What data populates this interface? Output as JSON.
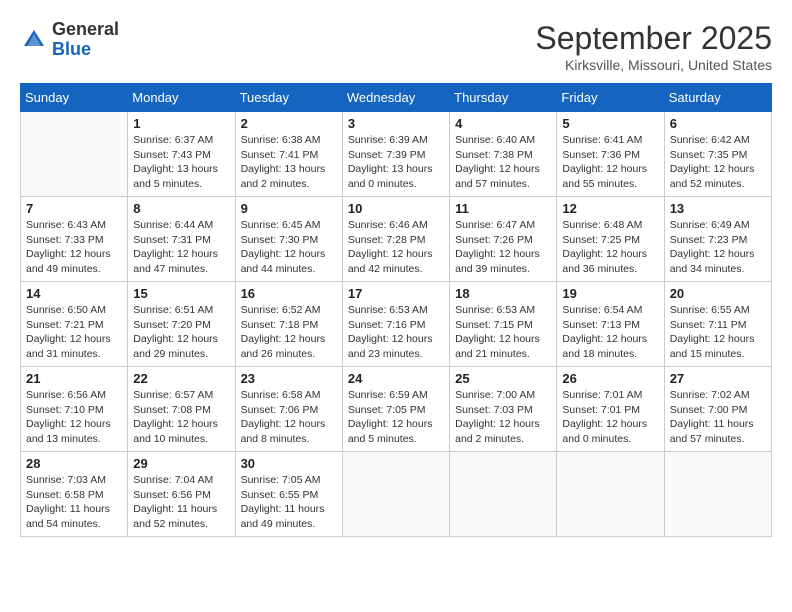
{
  "logo": {
    "general": "General",
    "blue": "Blue"
  },
  "header": {
    "month": "September 2025",
    "location": "Kirksville, Missouri, United States"
  },
  "days_of_week": [
    "Sunday",
    "Monday",
    "Tuesday",
    "Wednesday",
    "Thursday",
    "Friday",
    "Saturday"
  ],
  "weeks": [
    [
      {
        "day": "",
        "sunrise": "",
        "sunset": "",
        "daylight": ""
      },
      {
        "day": "1",
        "sunrise": "Sunrise: 6:37 AM",
        "sunset": "Sunset: 7:43 PM",
        "daylight": "Daylight: 13 hours and 5 minutes."
      },
      {
        "day": "2",
        "sunrise": "Sunrise: 6:38 AM",
        "sunset": "Sunset: 7:41 PM",
        "daylight": "Daylight: 13 hours and 2 minutes."
      },
      {
        "day": "3",
        "sunrise": "Sunrise: 6:39 AM",
        "sunset": "Sunset: 7:39 PM",
        "daylight": "Daylight: 13 hours and 0 minutes."
      },
      {
        "day": "4",
        "sunrise": "Sunrise: 6:40 AM",
        "sunset": "Sunset: 7:38 PM",
        "daylight": "Daylight: 12 hours and 57 minutes."
      },
      {
        "day": "5",
        "sunrise": "Sunrise: 6:41 AM",
        "sunset": "Sunset: 7:36 PM",
        "daylight": "Daylight: 12 hours and 55 minutes."
      },
      {
        "day": "6",
        "sunrise": "Sunrise: 6:42 AM",
        "sunset": "Sunset: 7:35 PM",
        "daylight": "Daylight: 12 hours and 52 minutes."
      }
    ],
    [
      {
        "day": "7",
        "sunrise": "Sunrise: 6:43 AM",
        "sunset": "Sunset: 7:33 PM",
        "daylight": "Daylight: 12 hours and 49 minutes."
      },
      {
        "day": "8",
        "sunrise": "Sunrise: 6:44 AM",
        "sunset": "Sunset: 7:31 PM",
        "daylight": "Daylight: 12 hours and 47 minutes."
      },
      {
        "day": "9",
        "sunrise": "Sunrise: 6:45 AM",
        "sunset": "Sunset: 7:30 PM",
        "daylight": "Daylight: 12 hours and 44 minutes."
      },
      {
        "day": "10",
        "sunrise": "Sunrise: 6:46 AM",
        "sunset": "Sunset: 7:28 PM",
        "daylight": "Daylight: 12 hours and 42 minutes."
      },
      {
        "day": "11",
        "sunrise": "Sunrise: 6:47 AM",
        "sunset": "Sunset: 7:26 PM",
        "daylight": "Daylight: 12 hours and 39 minutes."
      },
      {
        "day": "12",
        "sunrise": "Sunrise: 6:48 AM",
        "sunset": "Sunset: 7:25 PM",
        "daylight": "Daylight: 12 hours and 36 minutes."
      },
      {
        "day": "13",
        "sunrise": "Sunrise: 6:49 AM",
        "sunset": "Sunset: 7:23 PM",
        "daylight": "Daylight: 12 hours and 34 minutes."
      }
    ],
    [
      {
        "day": "14",
        "sunrise": "Sunrise: 6:50 AM",
        "sunset": "Sunset: 7:21 PM",
        "daylight": "Daylight: 12 hours and 31 minutes."
      },
      {
        "day": "15",
        "sunrise": "Sunrise: 6:51 AM",
        "sunset": "Sunset: 7:20 PM",
        "daylight": "Daylight: 12 hours and 29 minutes."
      },
      {
        "day": "16",
        "sunrise": "Sunrise: 6:52 AM",
        "sunset": "Sunset: 7:18 PM",
        "daylight": "Daylight: 12 hours and 26 minutes."
      },
      {
        "day": "17",
        "sunrise": "Sunrise: 6:53 AM",
        "sunset": "Sunset: 7:16 PM",
        "daylight": "Daylight: 12 hours and 23 minutes."
      },
      {
        "day": "18",
        "sunrise": "Sunrise: 6:53 AM",
        "sunset": "Sunset: 7:15 PM",
        "daylight": "Daylight: 12 hours and 21 minutes."
      },
      {
        "day": "19",
        "sunrise": "Sunrise: 6:54 AM",
        "sunset": "Sunset: 7:13 PM",
        "daylight": "Daylight: 12 hours and 18 minutes."
      },
      {
        "day": "20",
        "sunrise": "Sunrise: 6:55 AM",
        "sunset": "Sunset: 7:11 PM",
        "daylight": "Daylight: 12 hours and 15 minutes."
      }
    ],
    [
      {
        "day": "21",
        "sunrise": "Sunrise: 6:56 AM",
        "sunset": "Sunset: 7:10 PM",
        "daylight": "Daylight: 12 hours and 13 minutes."
      },
      {
        "day": "22",
        "sunrise": "Sunrise: 6:57 AM",
        "sunset": "Sunset: 7:08 PM",
        "daylight": "Daylight: 12 hours and 10 minutes."
      },
      {
        "day": "23",
        "sunrise": "Sunrise: 6:58 AM",
        "sunset": "Sunset: 7:06 PM",
        "daylight": "Daylight: 12 hours and 8 minutes."
      },
      {
        "day": "24",
        "sunrise": "Sunrise: 6:59 AM",
        "sunset": "Sunset: 7:05 PM",
        "daylight": "Daylight: 12 hours and 5 minutes."
      },
      {
        "day": "25",
        "sunrise": "Sunrise: 7:00 AM",
        "sunset": "Sunset: 7:03 PM",
        "daylight": "Daylight: 12 hours and 2 minutes."
      },
      {
        "day": "26",
        "sunrise": "Sunrise: 7:01 AM",
        "sunset": "Sunset: 7:01 PM",
        "daylight": "Daylight: 12 hours and 0 minutes."
      },
      {
        "day": "27",
        "sunrise": "Sunrise: 7:02 AM",
        "sunset": "Sunset: 7:00 PM",
        "daylight": "Daylight: 11 hours and 57 minutes."
      }
    ],
    [
      {
        "day": "28",
        "sunrise": "Sunrise: 7:03 AM",
        "sunset": "Sunset: 6:58 PM",
        "daylight": "Daylight: 11 hours and 54 minutes."
      },
      {
        "day": "29",
        "sunrise": "Sunrise: 7:04 AM",
        "sunset": "Sunset: 6:56 PM",
        "daylight": "Daylight: 11 hours and 52 minutes."
      },
      {
        "day": "30",
        "sunrise": "Sunrise: 7:05 AM",
        "sunset": "Sunset: 6:55 PM",
        "daylight": "Daylight: 11 hours and 49 minutes."
      },
      {
        "day": "",
        "sunrise": "",
        "sunset": "",
        "daylight": ""
      },
      {
        "day": "",
        "sunrise": "",
        "sunset": "",
        "daylight": ""
      },
      {
        "day": "",
        "sunrise": "",
        "sunset": "",
        "daylight": ""
      },
      {
        "day": "",
        "sunrise": "",
        "sunset": "",
        "daylight": ""
      }
    ]
  ]
}
